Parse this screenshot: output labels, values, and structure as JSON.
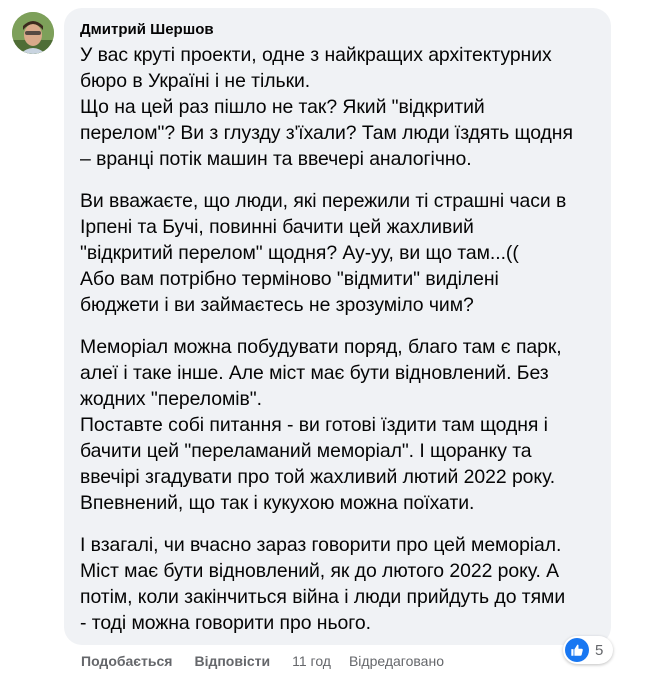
{
  "comment": {
    "author": "Дмитрий Шершов",
    "paragraphs": [
      "У вас круті проекти, одне з найкращих архітектурних\nбюро в Україні і не тільки.\nЩо на цей раз пішло не так? Який \"відкритий\nперелом\"? Ви з глузду з'їхали? Там люди їздять щодня\n– вранці потік машин та ввечері аналогічно.",
      "Ви вважаєте, що люди, які пережили ті страшні часи в\nІрпені та Бучі, повинні бачити цей жахливий\n\"відкритий перелом\" щодня? Ау-уу, ви що там...((\nАбо вам потрібно терміново \"відмити\" виділені\nбюджети і ви займаєтесь не зрозуміло чим?",
      "Меморіал можна побудувати поряд, благо там є парк,\nалеї і таке інше. Але міст має бути відновлений. Без\nжодних \"переломів\".\nПоставте собі питання - ви готові їздити там щодня і\nбачити цей \"переламаний меморіал\". І щоранку та\nввечірі згадувати про той жахливий лютий 2022 року.\nВпевнений, що так і кукухою можна поїхати.",
      "І взагалі, чи вчасно зараз говорити про цей меморіал.\nМіст має бути відновлений, як до лютого 2022 року. А\nпотім, коли закінчиться війна і люди прийдуть до тями\n- тоді можна говорити про нього."
    ],
    "reactions": {
      "icon": "like-icon",
      "count": "5",
      "color": "#1877f2"
    },
    "actions": {
      "like_label": "Подобається",
      "reply_label": "Відповісти",
      "time": "11 год",
      "edited": "Відредаговано"
    }
  }
}
